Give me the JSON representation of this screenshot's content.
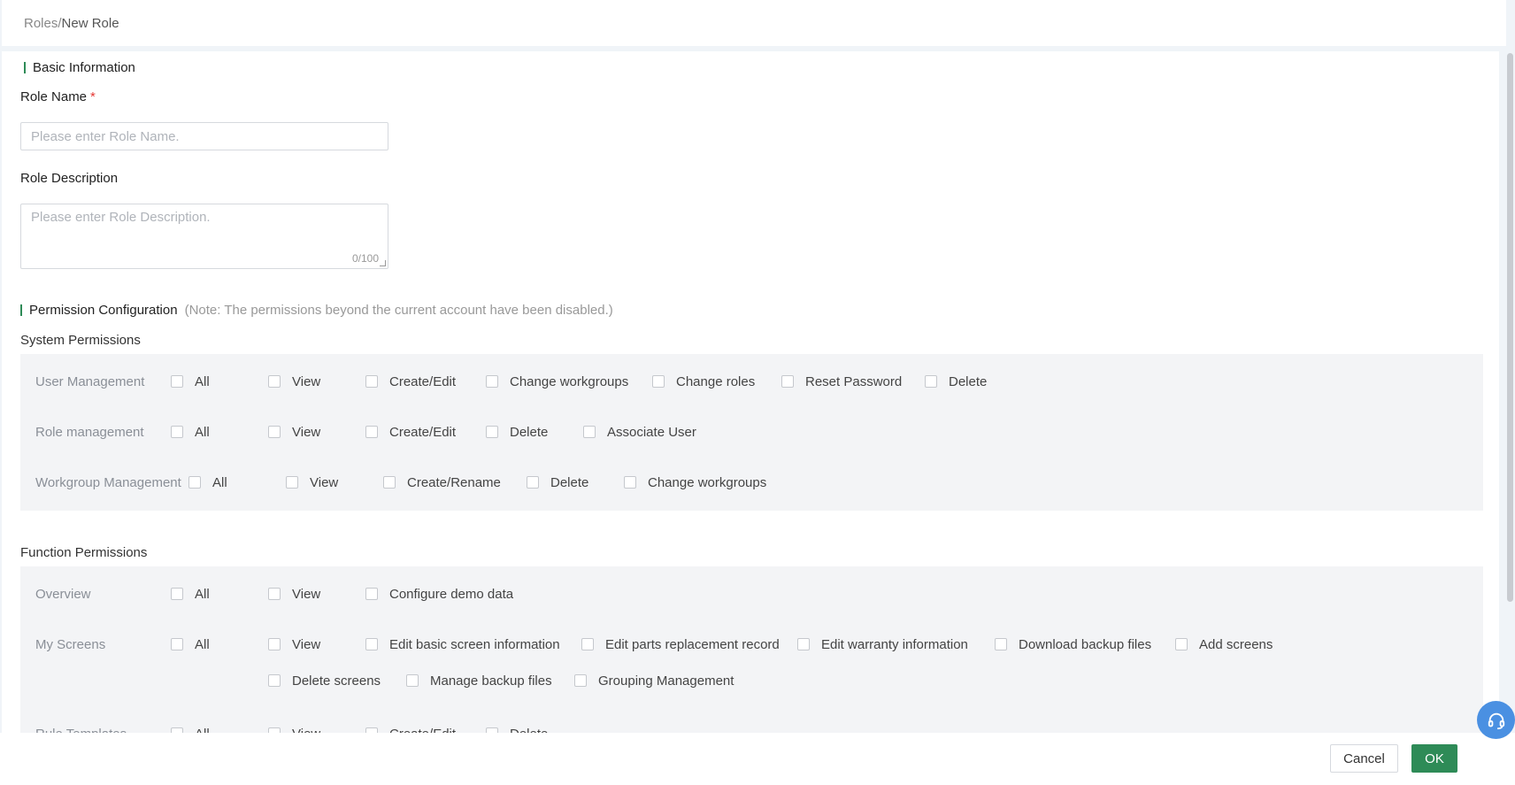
{
  "breadcrumb": {
    "root": "Roles/",
    "current": " New Role"
  },
  "basic": {
    "section_title": "Basic Information",
    "role_name_label": "Role Name",
    "required_mark": "*",
    "role_name_placeholder": "Please enter Role Name.",
    "role_desc_label": "Role Description",
    "role_desc_placeholder": "Please enter Role Description.",
    "role_desc_counter": "0/100"
  },
  "permissions": {
    "section_title": "Permission Configuration",
    "note": "(Note: The permissions beyond the current account have been disabled.)",
    "system": {
      "title": "System Permissions",
      "rows": [
        {
          "label": "User Management",
          "options": [
            "All",
            "View",
            "Create/Edit",
            "Change workgroups",
            "Change roles",
            "Reset Password",
            "Delete"
          ]
        },
        {
          "label": "Role management",
          "options": [
            "All",
            "View",
            "Create/Edit",
            "Delete",
            "Associate User"
          ]
        },
        {
          "label": "Workgroup Management",
          "options": [
            "All",
            "View",
            "Create/Rename",
            "Delete",
            "Change workgroups"
          ]
        }
      ]
    },
    "function": {
      "title": "Function Permissions",
      "rows": [
        {
          "label": "Overview",
          "options": [
            "All",
            "View",
            "Configure demo data"
          ]
        },
        {
          "label": "My Screens",
          "options": [
            "All",
            "View",
            "Edit basic screen information",
            "Edit parts replacement record",
            "Edit warranty information",
            "Download backup files",
            "Add screens",
            "Delete screens",
            "Manage backup files",
            "Grouping Management"
          ]
        },
        {
          "label": "Rule Templates",
          "options": [
            "All",
            "View",
            "Create/Edit",
            "Delete"
          ]
        }
      ]
    }
  },
  "footer": {
    "cancel": "Cancel",
    "ok": "OK"
  },
  "icons": {
    "help": "headset-icon"
  },
  "colors": {
    "accent": "#2e8b57",
    "help": "#4a90e2",
    "required": "#e53935"
  }
}
